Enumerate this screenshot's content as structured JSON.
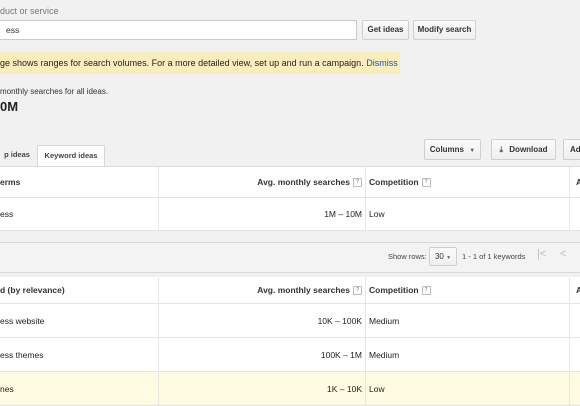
{
  "search": {
    "field_label": "duct or service",
    "query_value": "ess",
    "get_ideas_label": "Get ideas",
    "modify_search_label": "Modify search"
  },
  "notice": {
    "text": "ge shows ranges for search volumes. For a more detailed view, set up and run a campaign.",
    "dismiss_label": "Dismiss"
  },
  "summary": {
    "caption": "monthly searches for all ideas.",
    "value": "0M"
  },
  "tabs": [
    {
      "label": "p ideas",
      "active": false
    },
    {
      "label": "Keyword ideas",
      "active": true
    }
  ],
  "toolbar": {
    "columns_label": "Columns",
    "download_label": "Download",
    "add_label": "Ad"
  },
  "search_terms_table": {
    "headers": {
      "term": "erms",
      "searches": "Avg. monthly searches",
      "competition": "Competition",
      "extra": "A"
    },
    "rows": [
      {
        "term": "ess",
        "searches": "1M – 10M",
        "competition": "Low"
      }
    ]
  },
  "pager": {
    "show_rows_label": "Show rows:",
    "rows_value": "30",
    "range_text": "1 - 1 of 1 keywords"
  },
  "ideas_table": {
    "headers": {
      "term": "d (by relevance)",
      "searches": "Avg. monthly searches",
      "competition": "Competition",
      "extra": "A"
    },
    "rows": [
      {
        "term": "ess website",
        "searches": "10K – 100K",
        "competition": "Medium",
        "highlight": false
      },
      {
        "term": "ess themes",
        "searches": "100K – 1M",
        "competition": "Medium",
        "highlight": false
      },
      {
        "term": "nes",
        "searches": "1K – 10K",
        "competition": "Low",
        "highlight": true
      }
    ]
  },
  "icons": {
    "help": "question-icon",
    "download": "download-icon",
    "dropdown": "chevron-down-icon",
    "first_page": "first-page-icon",
    "prev_page": "previous-page-icon"
  },
  "colors": {
    "notice_bg": "#f9edbe",
    "link": "#1155cc",
    "highlight_row": "#fffbe3"
  }
}
